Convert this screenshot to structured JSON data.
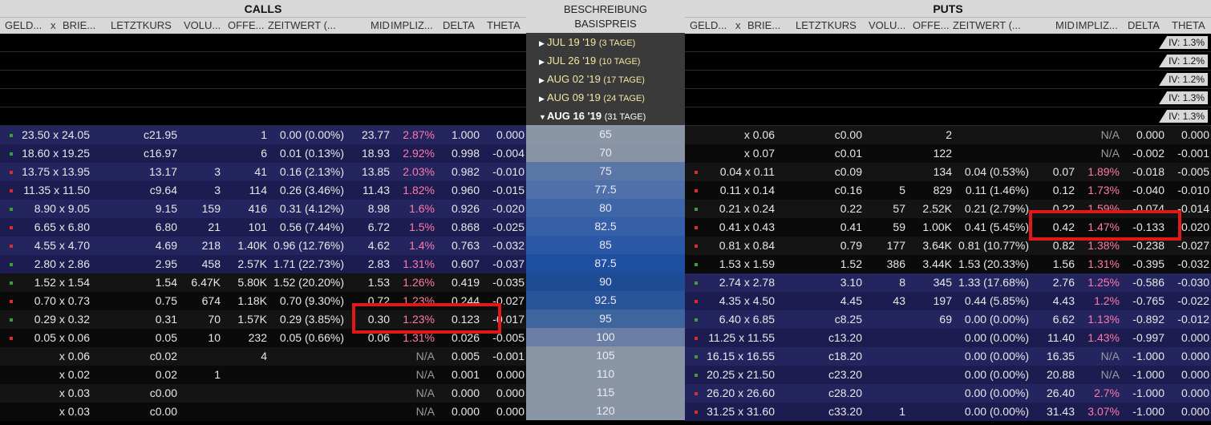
{
  "calls": {
    "title": "CALLS",
    "headers": [
      "GELD...",
      "x",
      "BRIE...",
      "LETZTKURS",
      "VOLU...",
      "OFFE...",
      "ZEITWERT (...",
      "MID",
      "IMPLIZ...",
      "DELTA",
      "THETA"
    ],
    "rows": [
      {
        "bid": "23.50",
        "ask": "24.05",
        "last": "c21.95",
        "vol": "",
        "oi": "1",
        "tv": "0.00 (0.00%)",
        "mid": "23.77",
        "iv": "2.87%",
        "delta": "1.000",
        "theta": "0.000"
      },
      {
        "bid": "18.60",
        "ask": "19.25",
        "last": "c16.97",
        "vol": "",
        "oi": "6",
        "tv": "0.01 (0.13%)",
        "mid": "18.93",
        "iv": "2.92%",
        "delta": "0.998",
        "theta": "-0.004"
      },
      {
        "bid": "13.75",
        "ask": "13.95",
        "last": "13.17",
        "vol": "3",
        "oi": "41",
        "tv": "0.16 (2.13%)",
        "mid": "13.85",
        "iv": "2.03%",
        "delta": "0.982",
        "theta": "-0.010"
      },
      {
        "bid": "11.35",
        "ask": "11.50",
        "last": "c9.64",
        "vol": "3",
        "oi": "114",
        "tv": "0.26 (3.46%)",
        "mid": "11.43",
        "iv": "1.82%",
        "delta": "0.960",
        "theta": "-0.015"
      },
      {
        "bid": "8.90",
        "ask": "9.05",
        "last": "9.15",
        "vol": "159",
        "oi": "416",
        "tv": "0.31 (4.12%)",
        "mid": "8.98",
        "iv": "1.6%",
        "delta": "0.926",
        "theta": "-0.020"
      },
      {
        "bid": "6.65",
        "ask": "6.80",
        "last": "6.80",
        "vol": "21",
        "oi": "101",
        "tv": "0.56 (7.44%)",
        "mid": "6.72",
        "iv": "1.5%",
        "delta": "0.868",
        "theta": "-0.025"
      },
      {
        "bid": "4.55",
        "ask": "4.70",
        "last": "4.69",
        "vol": "218",
        "oi": "1.40K",
        "tv": "0.96 (12.76%)",
        "mid": "4.62",
        "iv": "1.4%",
        "delta": "0.763",
        "theta": "-0.032"
      },
      {
        "bid": "2.80",
        "ask": "2.86",
        "last": "2.95",
        "vol": "458",
        "oi": "2.57K",
        "tv": "1.71 (22.73%)",
        "mid": "2.83",
        "iv": "1.31%",
        "delta": "0.607",
        "theta": "-0.037"
      },
      {
        "bid": "1.52",
        "ask": "1.54",
        "last": "1.54",
        "vol": "6.47K",
        "oi": "5.80K",
        "tv": "1.52 (20.20%)",
        "mid": "1.53",
        "iv": "1.26%",
        "delta": "0.419",
        "theta": "-0.035"
      },
      {
        "bid": "0.70",
        "ask": "0.73",
        "last": "0.75",
        "vol": "674",
        "oi": "1.18K",
        "tv": "0.70 (9.30%)",
        "mid": "0.72",
        "iv": "1.23%",
        "delta": "0.244",
        "theta": "-0.027"
      },
      {
        "bid": "0.29",
        "ask": "0.32",
        "last": "0.31",
        "vol": "70",
        "oi": "1.57K",
        "tv": "0.29 (3.85%)",
        "mid": "0.30",
        "iv": "1.23%",
        "delta": "0.123",
        "theta": "-0.017"
      },
      {
        "bid": "0.05",
        "ask": "0.06",
        "last": "0.05",
        "vol": "10",
        "oi": "232",
        "tv": "0.05 (0.66%)",
        "mid": "0.06",
        "iv": "1.31%",
        "delta": "0.026",
        "theta": "-0.005"
      },
      {
        "bid": "",
        "ask": "0.06",
        "last": "c0.02",
        "vol": "",
        "oi": "4",
        "tv": "",
        "mid": "",
        "iv": "N/A",
        "delta": "0.005",
        "theta": "-0.001"
      },
      {
        "bid": "",
        "ask": "0.02",
        "last": "0.02",
        "vol": "1",
        "oi": "",
        "tv": "",
        "mid": "",
        "iv": "N/A",
        "delta": "0.001",
        "theta": "0.000"
      },
      {
        "bid": "",
        "ask": "0.03",
        "last": "c0.00",
        "vol": "",
        "oi": "",
        "tv": "",
        "mid": "",
        "iv": "N/A",
        "delta": "0.000",
        "theta": "0.000"
      },
      {
        "bid": "",
        "ask": "0.03",
        "last": "c0.00",
        "vol": "",
        "oi": "",
        "tv": "",
        "mid": "",
        "iv": "N/A",
        "delta": "0.000",
        "theta": "0.000"
      }
    ]
  },
  "middle": {
    "header_line1": "BESCHREIBUNG",
    "header_line2": "BASISPREIS",
    "expirations": [
      {
        "date": "JUL 19 '19",
        "days": "(3 TAGE)",
        "expanded": false
      },
      {
        "date": "JUL 26 '19",
        "days": "(10 TAGE)",
        "expanded": false
      },
      {
        "date": "AUG 02 '19",
        "days": "(17 TAGE)",
        "expanded": false
      },
      {
        "date": "AUG 09 '19",
        "days": "(24 TAGE)",
        "expanded": false
      },
      {
        "date": "AUG 16 '19",
        "days": "(31 TAGE)",
        "expanded": true
      }
    ],
    "strikes": [
      "65",
      "70",
      "75",
      "77.5",
      "80",
      "82.5",
      "85",
      "87.5",
      "90",
      "92.5",
      "95",
      "100",
      "105",
      "110",
      "115",
      "120"
    ]
  },
  "puts": {
    "title": "PUTS",
    "headers": [
      "GELD...",
      "x",
      "BRIE...",
      "LETZTKURS",
      "VOLU...",
      "OFFE...",
      "ZEITWERT (...",
      "MID",
      "IMPLIZ...",
      "DELTA",
      "THETA"
    ],
    "iv_badges": [
      "IV: 1.3%",
      "IV: 1.2%",
      "IV: 1.2%",
      "IV: 1.3%",
      "IV: 1.3%"
    ],
    "rows": [
      {
        "bid": "",
        "ask": "0.06",
        "last": "c0.00",
        "vol": "",
        "oi": "2",
        "tv": "",
        "mid": "",
        "iv": "N/A",
        "delta": "0.000",
        "theta": "0.000"
      },
      {
        "bid": "",
        "ask": "0.07",
        "last": "c0.01",
        "vol": "",
        "oi": "122",
        "tv": "",
        "mid": "",
        "iv": "N/A",
        "delta": "-0.002",
        "theta": "-0.001"
      },
      {
        "bid": "0.04",
        "ask": "0.11",
        "last": "c0.09",
        "vol": "",
        "oi": "134",
        "tv": "0.04 (0.53%)",
        "mid": "0.07",
        "iv": "1.89%",
        "delta": "-0.018",
        "theta": "-0.005"
      },
      {
        "bid": "0.11",
        "ask": "0.14",
        "last": "c0.16",
        "vol": "5",
        "oi": "829",
        "tv": "0.11 (1.46%)",
        "mid": "0.12",
        "iv": "1.73%",
        "delta": "-0.040",
        "theta": "-0.010"
      },
      {
        "bid": "0.21",
        "ask": "0.24",
        "last": "0.22",
        "vol": "57",
        "oi": "2.52K",
        "tv": "0.21 (2.79%)",
        "mid": "0.22",
        "iv": "1.59%",
        "delta": "-0.074",
        "theta": "-0.014"
      },
      {
        "bid": "0.41",
        "ask": "0.43",
        "last": "0.41",
        "vol": "59",
        "oi": "1.00K",
        "tv": "0.41 (5.45%)",
        "mid": "0.42",
        "iv": "1.47%",
        "delta": "-0.133",
        "theta": "-0.020"
      },
      {
        "bid": "0.81",
        "ask": "0.84",
        "last": "0.79",
        "vol": "177",
        "oi": "3.64K",
        "tv": "0.81 (10.77%)",
        "mid": "0.82",
        "iv": "1.38%",
        "delta": "-0.238",
        "theta": "-0.027"
      },
      {
        "bid": "1.53",
        "ask": "1.59",
        "last": "1.52",
        "vol": "386",
        "oi": "3.44K",
        "tv": "1.53 (20.33%)",
        "mid": "1.56",
        "iv": "1.31%",
        "delta": "-0.395",
        "theta": "-0.032"
      },
      {
        "bid": "2.74",
        "ask": "2.78",
        "last": "3.10",
        "vol": "8",
        "oi": "345",
        "tv": "1.33 (17.68%)",
        "mid": "2.76",
        "iv": "1.25%",
        "delta": "-0.586",
        "theta": "-0.030"
      },
      {
        "bid": "4.35",
        "ask": "4.50",
        "last": "4.45",
        "vol": "43",
        "oi": "197",
        "tv": "0.44 (5.85%)",
        "mid": "4.43",
        "iv": "1.2%",
        "delta": "-0.765",
        "theta": "-0.022"
      },
      {
        "bid": "6.40",
        "ask": "6.85",
        "last": "c8.25",
        "vol": "",
        "oi": "69",
        "tv": "0.00 (0.00%)",
        "mid": "6.62",
        "iv": "1.13%",
        "delta": "-0.892",
        "theta": "-0.012"
      },
      {
        "bid": "11.25",
        "ask": "11.55",
        "last": "c13.20",
        "vol": "",
        "oi": "",
        "tv": "0.00 (0.00%)",
        "mid": "11.40",
        "iv": "1.43%",
        "delta": "-0.997",
        "theta": "0.000"
      },
      {
        "bid": "16.15",
        "ask": "16.55",
        "last": "c18.20",
        "vol": "",
        "oi": "",
        "tv": "0.00 (0.00%)",
        "mid": "16.35",
        "iv": "N/A",
        "delta": "-1.000",
        "theta": "0.000"
      },
      {
        "bid": "20.25",
        "ask": "21.50",
        "last": "c23.20",
        "vol": "",
        "oi": "",
        "tv": "0.00 (0.00%)",
        "mid": "20.88",
        "iv": "N/A",
        "delta": "-1.000",
        "theta": "0.000"
      },
      {
        "bid": "26.20",
        "ask": "26.60",
        "last": "c28.20",
        "vol": "",
        "oi": "",
        "tv": "0.00 (0.00%)",
        "mid": "26.40",
        "iv": "2.7%",
        "delta": "-1.000",
        "theta": "0.000"
      },
      {
        "bid": "31.25",
        "ask": "31.60",
        "last": "c33.20",
        "vol": "1",
        "oi": "",
        "tv": "0.00 (0.00%)",
        "mid": "31.43",
        "iv": "3.07%",
        "delta": "-1.000",
        "theta": "0.000"
      }
    ]
  },
  "colors": {
    "header_bg": "#d8d8d8",
    "implied_vol": "#ff7aa8",
    "highlight_box": "#e01818",
    "strike_itm": "#1e4c94",
    "strike_otm": "#8a95a6"
  }
}
